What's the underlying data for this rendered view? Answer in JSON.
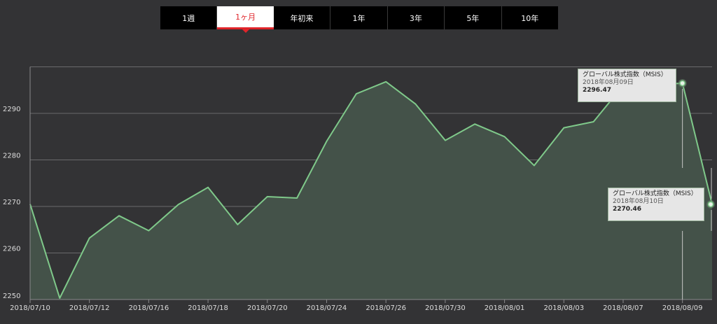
{
  "tabs": [
    {
      "label": "1週",
      "active": false
    },
    {
      "label": "1ヶ月",
      "active": true
    },
    {
      "label": "年初来",
      "active": false
    },
    {
      "label": "1年",
      "active": false
    },
    {
      "label": "3年",
      "active": false
    },
    {
      "label": "5年",
      "active": false
    },
    {
      "label": "10年",
      "active": false
    }
  ],
  "tooltips": [
    {
      "series": "グローバル株式指数（MSIS）",
      "date": "2018年08月09日",
      "value": "2296.47"
    },
    {
      "series": "グローバル株式指数（MSIS）",
      "date": "2018年08月10日",
      "value": "2270.46"
    }
  ],
  "colors": {
    "line": "#7fc98a",
    "fill": "#445249",
    "active_tab": "#e0242a"
  },
  "chart_data": {
    "type": "area",
    "x": [
      "2018/07/10",
      "2018/07/11",
      "2018/07/12",
      "2018/07/13",
      "2018/07/16",
      "2018/07/17",
      "2018/07/18",
      "2018/07/19",
      "2018/07/20",
      "2018/07/23",
      "2018/07/24",
      "2018/07/25",
      "2018/07/26",
      "2018/07/27",
      "2018/07/30",
      "2018/07/31",
      "2018/08/01",
      "2018/08/02",
      "2018/08/03",
      "2018/08/06",
      "2018/08/07",
      "2018/08/08",
      "2018/08/09",
      "2018/08/10"
    ],
    "values": [
      2270.5,
      2250.3,
      2263.2,
      2268.0,
      2264.8,
      2270.4,
      2274.1,
      2266.1,
      2272.1,
      2271.8,
      2284.0,
      2294.2,
      2296.8,
      2292.0,
      2284.2,
      2287.7,
      2285.0,
      2278.8,
      2286.9,
      2288.2,
      2296.0,
      2296.2,
      2296.47,
      2270.46
    ],
    "xticks": [
      "2018/07/10",
      "2018/07/12",
      "2018/07/16",
      "2018/07/18",
      "2018/07/20",
      "2018/07/24",
      "2018/07/26",
      "2018/07/30",
      "2018/08/01",
      "2018/08/03",
      "2018/08/07",
      "2018/08/09"
    ],
    "yticks": [
      2250,
      2260,
      2270,
      2280,
      2290
    ],
    "ylim": [
      2250,
      2300
    ],
    "grid": true,
    "legend": "none"
  }
}
